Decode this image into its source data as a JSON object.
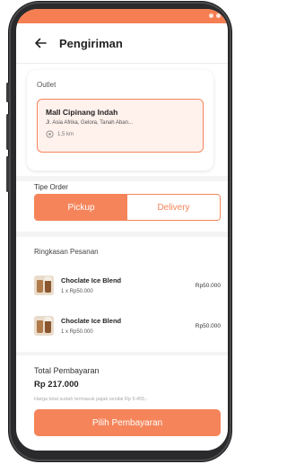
{
  "colors": {
    "accent": "#f5845a",
    "accent_light": "#fff1ec",
    "status_bar": "#f57e53",
    "frame": "#2a2a2c"
  },
  "header": {
    "title": "Pengiriman",
    "back_icon": "arrow-left-icon"
  },
  "outlet": {
    "section_label": "Outlet",
    "name": "Mall Cipinang Indah",
    "address": "Jl. Asia Afrika, Gelora, Tanah Aban...",
    "distance": "1,5 km",
    "distance_icon": "location-pin-icon"
  },
  "order_type": {
    "section_label": "Tipe Order",
    "options": [
      "Pickup",
      "Delivery"
    ],
    "selected": "Pickup"
  },
  "summary": {
    "section_label": "Ringkasan Pesanan",
    "items": [
      {
        "name": "Choclate Ice Blend",
        "qty": "1 x Rp50.000",
        "price": "Rp50.000"
      },
      {
        "name": "Choclate Ice Blend",
        "qty": "1 x Rp50.000",
        "price": "Rp50.000"
      }
    ]
  },
  "payment": {
    "total_label": "Total Pembayaran",
    "total_value": "Rp 217.000",
    "tax_note": "Harga total sudah termasuk pajak senilai Rp 9.455,-",
    "button_label": "Pilih Pembayaran"
  }
}
